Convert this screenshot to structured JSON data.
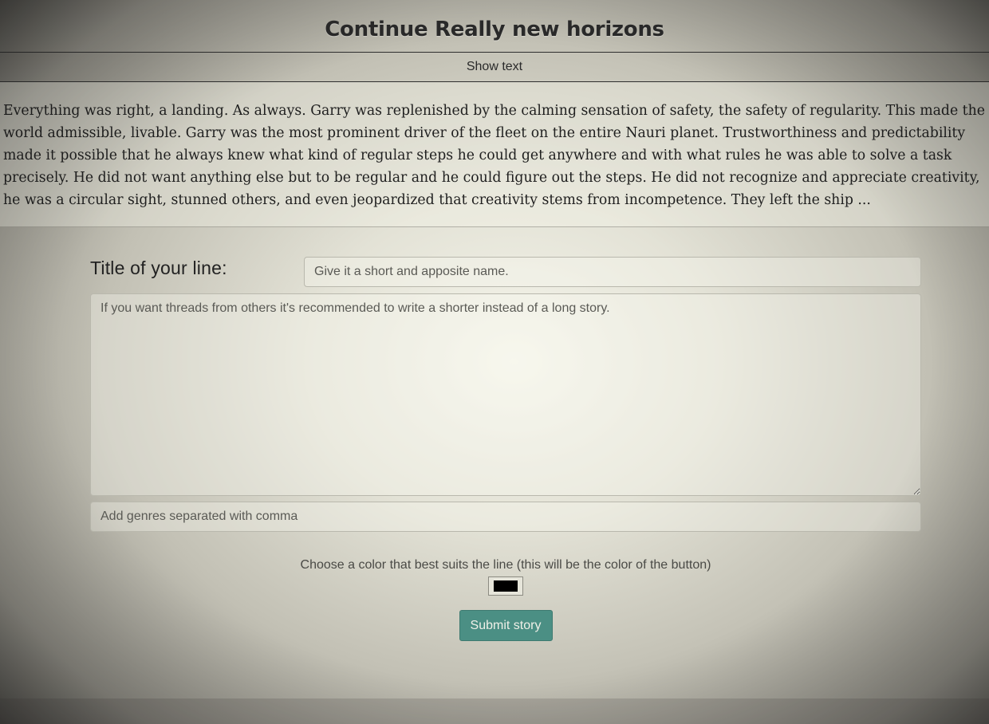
{
  "header": {
    "title": "Continue Really new horizons"
  },
  "show_text": {
    "label": "Show text"
  },
  "story": {
    "text": "Everything was right, a landing. As always. Garry was replenished by the calming sensation of safety, the safety of regularity. This made the world admissible, livable. Garry was the most prominent driver of the fleet on the entire Nauri planet. Trustworthiness and predictability made it possible that he always knew what kind of regular steps he could get anywhere and with what rules he was able to solve a task precisely. He did not want anything else but to be regular and he could figure out the steps. He did not recognize and appreciate creativity, he was a circular sight, stunned others, and even jeopardized that creativity stems from incompetence. They left the ship ..."
  },
  "form": {
    "title_label": "Title of your line:",
    "title_placeholder": "Give it a short and apposite name.",
    "title_value": "",
    "story_placeholder": "If you want threads from others it's recommended to write a shorter instead of a long story.",
    "story_value": "",
    "genres_placeholder": "Add genres separated with comma",
    "genres_value": "",
    "color_label": "Choose a color that best suits the line (this will be the color of the button)",
    "color_value": "#000000",
    "submit_label": "Submit story"
  },
  "colors": {
    "submit_button": "#4b8f84",
    "selected_color": "#000000"
  }
}
